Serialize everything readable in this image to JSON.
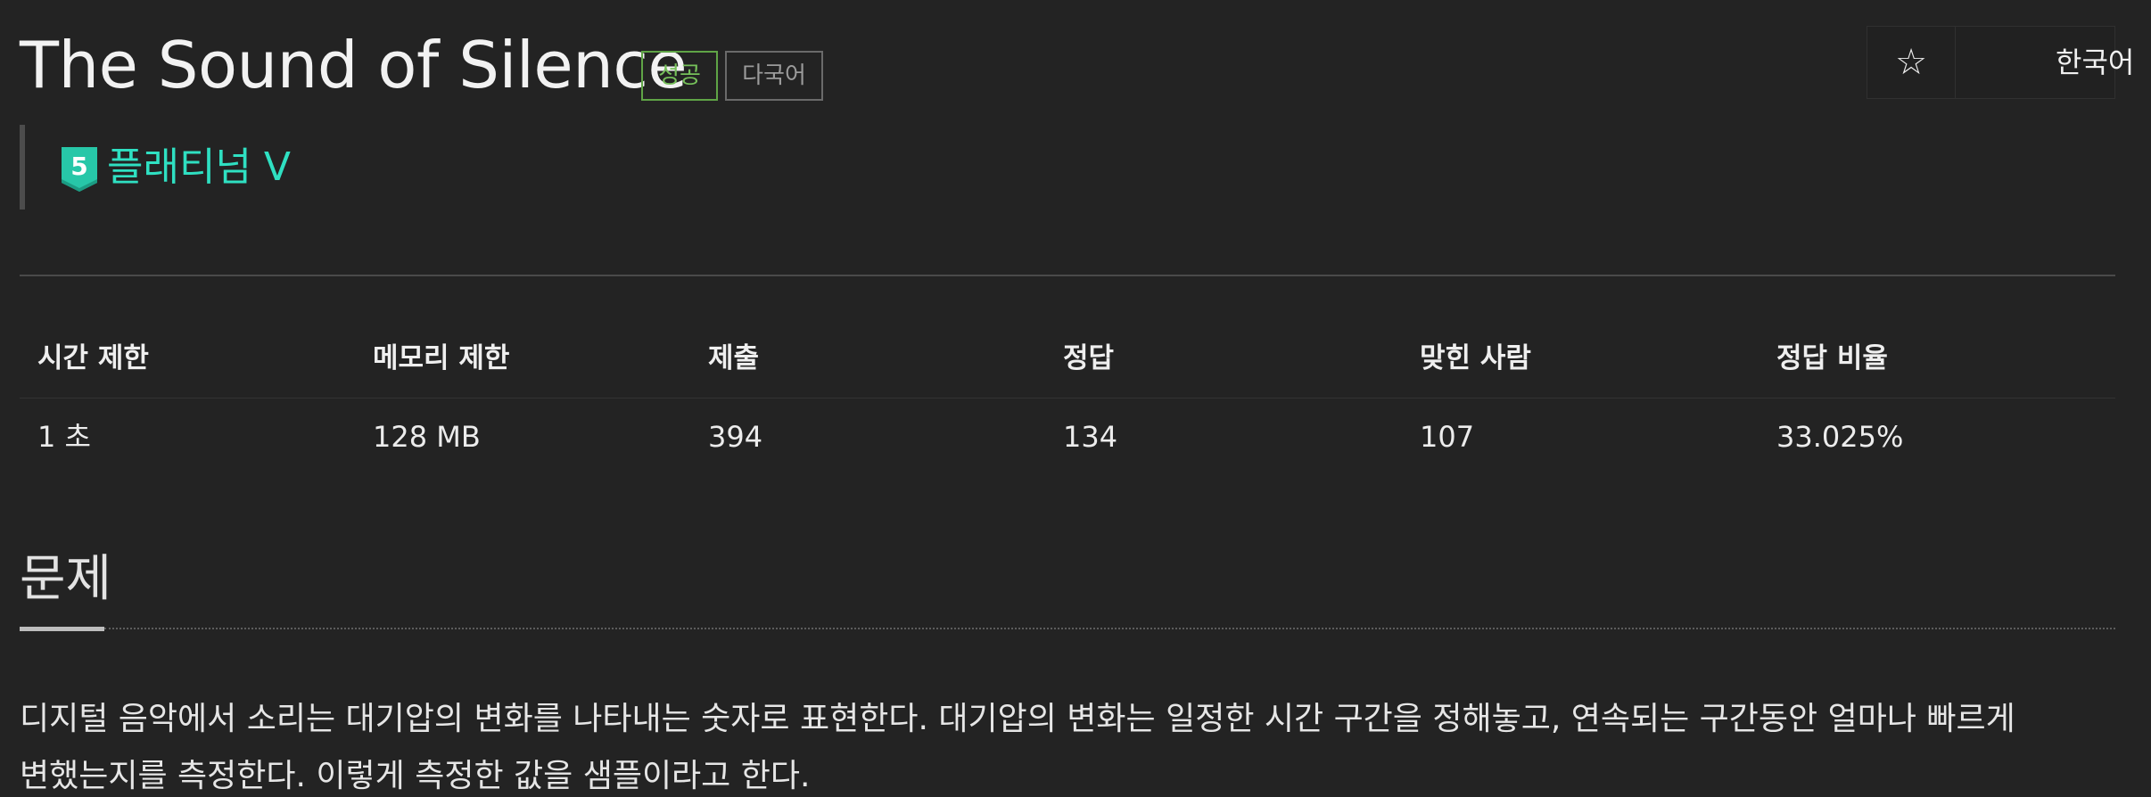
{
  "header": {
    "title": "The Sound of Silence",
    "badges": {
      "success": "성공",
      "multilang": "다국어"
    },
    "tier": {
      "number": "5",
      "label": "플래티넘 V",
      "color": "#2fe0c2"
    }
  },
  "toolbar": {
    "star_icon": "star-outline-icon",
    "star_glyph": "☆",
    "language": "한국어"
  },
  "stats": {
    "headers": [
      "시간 제한",
      "메모리 제한",
      "제출",
      "정답",
      "맞힌 사람",
      "정답 비율"
    ],
    "values": [
      "1 초",
      "128 MB",
      "394",
      "134",
      "107",
      "33.025%"
    ]
  },
  "problem": {
    "section_title": "문제",
    "lines": [
      "디지털 음악에서 소리는 대기압의 변화를 나타내는 숫자로 표현한다. 대기압의 변화는 일정한 시간 구간을 정해놓고, 연속되는 구간동안 얼마나 빠르게",
      "변했는지를 측정한다. 이렇게 측정한 값을 샘플이라고 한다."
    ]
  },
  "colors": {
    "background": "#232323",
    "success_badge": "#76c05a",
    "tier_platinum": "#2fe0c2"
  }
}
